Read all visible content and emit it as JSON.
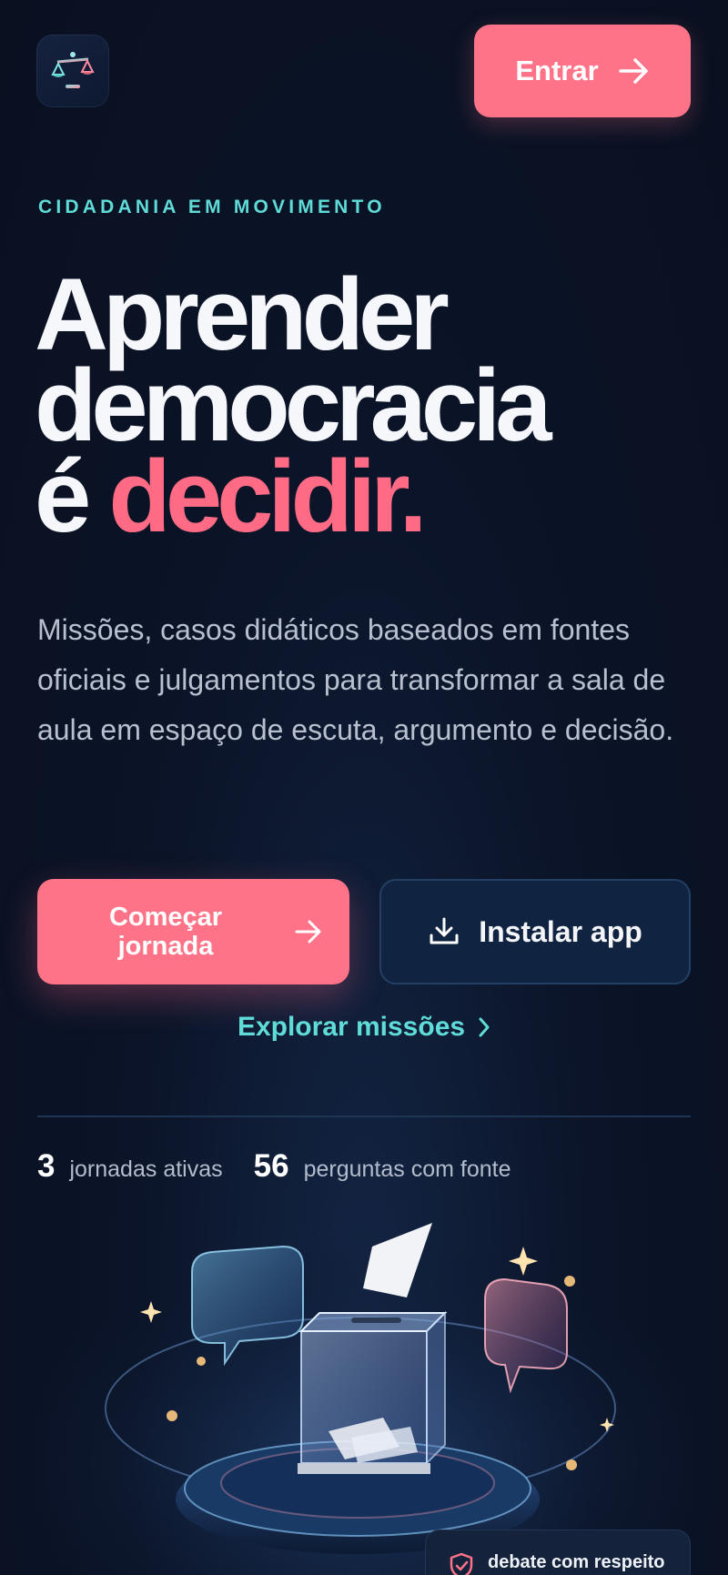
{
  "header": {
    "logo_icon": "scales-of-justice-icon",
    "login_label": "Entrar"
  },
  "hero": {
    "eyebrow": "CIDADANIA EM MOVIMENTO",
    "headline_line1": "Aprender",
    "headline_line2": "democracia",
    "headline_prefix": "é",
    "headline_accent": "decidir.",
    "lead": "Missões, casos didáticos baseados em fontes oficiais e julgamentos para transformar a sala de aula em espaço de escuta, argumento e decisão."
  },
  "actions": {
    "primary_line1": "Começar",
    "primary_line2": "jornada",
    "install_label": "Instalar app",
    "explore_label": "Explorar missões"
  },
  "stats": [
    {
      "value": "3",
      "label": "jornadas ativas"
    },
    {
      "value": "56",
      "label": "perguntas com fonte"
    }
  ],
  "illustration": {
    "subject": "ballot-box-with-speech-bubbles-illustration"
  },
  "badge": {
    "icon": "shield-check-icon",
    "label": "debate com respeito"
  },
  "colors": {
    "background": "#0a1224",
    "accent_pink": "#ff7388",
    "accent_teal": "#5fdcd8",
    "secondary_button": "#102340"
  }
}
